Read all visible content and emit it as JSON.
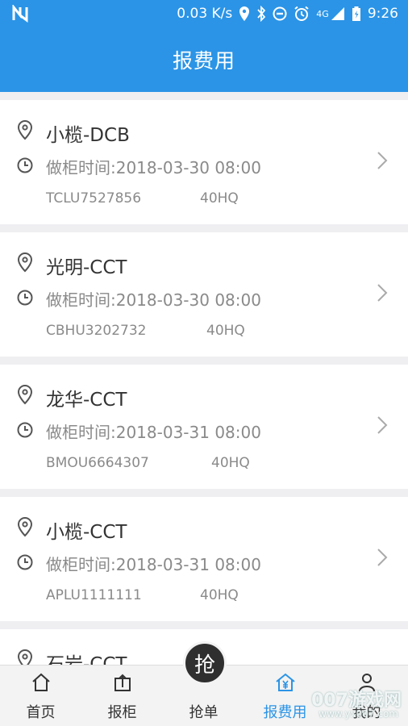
{
  "status_bar": {
    "net_speed": "0.03 K/s",
    "network": "4G",
    "time": "9:26"
  },
  "app_bar": {
    "title": "报费用"
  },
  "records": [
    {
      "title": "小榄-DCB",
      "time_label": "做柜时间:2018-03-30 08:00",
      "container_no": "TCLU7527856",
      "container_type": "40HQ"
    },
    {
      "title": "光明-CCT",
      "time_label": "做柜时间:2018-03-30 08:00",
      "container_no": "CBHU3202732",
      "container_type": "40HQ"
    },
    {
      "title": "龙华-CCT",
      "time_label": "做柜时间:2018-03-31 08:00",
      "container_no": "BMOU6664307",
      "container_type": "40HQ"
    },
    {
      "title": "小榄-CCT",
      "time_label": "做柜时间:2018-03-31 08:00",
      "container_no": "APLU1111111",
      "container_type": "40HQ"
    },
    {
      "title": "石岩-CCT",
      "time_label": "",
      "container_no": "",
      "container_type": ""
    }
  ],
  "tabs": [
    {
      "label": "首页",
      "icon": "home-icon"
    },
    {
      "label": "报柜",
      "icon": "upload-box-icon"
    },
    {
      "label": "抢单",
      "icon": "grab-order-icon"
    },
    {
      "label": "报费用",
      "icon": "yen-house-icon",
      "active": true
    },
    {
      "label": "我的",
      "icon": "user-icon"
    }
  ],
  "grab_button": {
    "label": "抢"
  },
  "watermark": {
    "text": "007游戏网",
    "url": "www.yx007.com"
  },
  "colors": {
    "primary": "#2b94e6",
    "text_dark": "#333333",
    "text_muted": "#8a8a8a",
    "background": "#efeff2"
  }
}
